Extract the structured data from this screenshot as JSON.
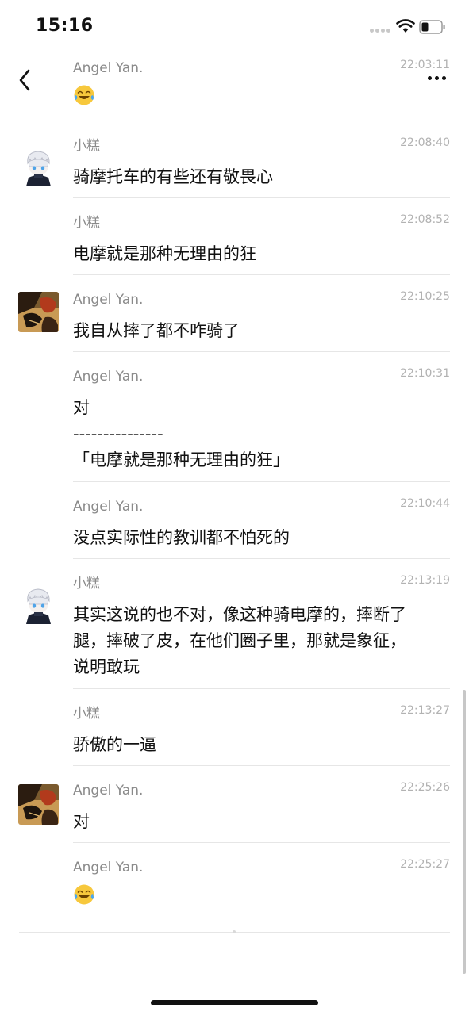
{
  "status_bar": {
    "time": "15:16"
  },
  "icons": {
    "back": "chevron-left-icon",
    "more": "more-dots-icon",
    "emoji": "crying-laughing-emoji"
  },
  "messages": [
    {
      "sender": "Angel Yan.",
      "time": "22:03:11",
      "text": [],
      "emoji": true
    },
    {
      "sender": "小糕",
      "time": "22:08:40",
      "text": [
        "骑摩托车的有些还有敬畏心"
      ]
    },
    {
      "sender": "小糕",
      "time": "22:08:52",
      "text": [
        "电摩就是那种无理由的狂"
      ]
    },
    {
      "sender": "Angel Yan.",
      "time": "22:10:25",
      "text": [
        "我自从摔了都不咋骑了"
      ]
    },
    {
      "sender": "Angel Yan.",
      "time": "22:10:31",
      "text": [
        "对",
        "---------------",
        "「电摩就是那种无理由的狂」"
      ]
    },
    {
      "sender": "Angel Yan.",
      "time": "22:10:44",
      "text": [
        "没点实际性的教训都不怕死的"
      ]
    },
    {
      "sender": "小糕",
      "time": "22:13:19",
      "text": [
        "其实这说的也不对，像这种骑电摩的，摔断了",
        "腿，摔破了皮，在他们圈子里，那就是象征，",
        "说明敢玩"
      ]
    },
    {
      "sender": "小糕",
      "time": "22:13:27",
      "text": [
        "骄傲的一逼"
      ]
    },
    {
      "sender": "Angel Yan.",
      "time": "22:25:26",
      "text": [
        "对"
      ]
    },
    {
      "sender": "Angel Yan.",
      "time": "22:25:27",
      "text": [],
      "emoji": true
    }
  ]
}
